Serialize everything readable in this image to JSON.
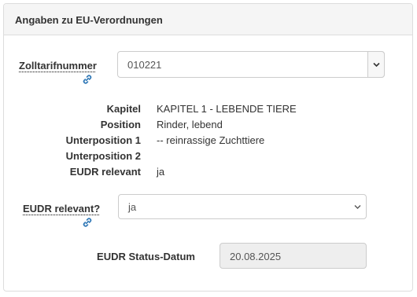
{
  "panel": {
    "title": "Angaben zu EU-Verordnungen"
  },
  "zolltarif": {
    "label": "Zolltarifnummer",
    "link_icon": "link-icon",
    "value": "010221"
  },
  "info": {
    "rows": [
      {
        "label": "Kapitel",
        "value": "KAPITEL 1 - LEBENDE TIERE"
      },
      {
        "label": "Position",
        "value": "Rinder, lebend"
      },
      {
        "label": "Unterposition 1",
        "value": "-- reinrassige Zuchttiere"
      },
      {
        "label": "Unterposition 2",
        "value": ""
      },
      {
        "label": "EUDR relevant",
        "value": "ja"
      }
    ]
  },
  "eudr": {
    "label": "EUDR relevant?",
    "link_icon": "link-icon",
    "selected": "ja"
  },
  "status": {
    "label": "EUDR Status-Datum",
    "value": "20.08.2025"
  },
  "colors": {
    "link_blue": "#337ab7",
    "header_bg": "#f5f5f5",
    "border": "#dddddd",
    "readonly_bg": "#eeeeee"
  }
}
